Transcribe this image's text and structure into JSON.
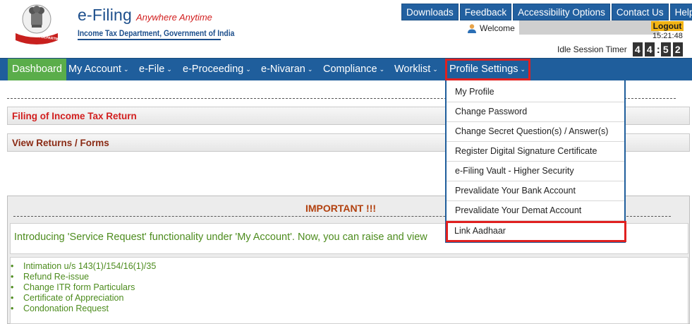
{
  "header": {
    "brand_title": "e-Filing",
    "brand_tagline": "Anywhere Anytime",
    "brand_subtitle": "Income Tax Department, Government of India",
    "emblem_caption": "INCOME TAX DEPARTMENT",
    "top_links": [
      "Downloads",
      "Feedback",
      "Accessibility Options",
      "Contact Us",
      "Help"
    ],
    "welcome_label": "Welcome",
    "logout_label": "Logout",
    "time": "15:21:48",
    "idle_label": "Idle Session Timer",
    "idle_digits": [
      "4",
      "4",
      "5",
      "2"
    ],
    "colors": {
      "brand_blue": "#1d4f8c",
      "tagline_red": "#d21f1f",
      "logout_bg": "#f3b414"
    }
  },
  "nav": {
    "items": [
      {
        "label": "Dashboard",
        "caret": false
      },
      {
        "label": "My Account",
        "caret": true
      },
      {
        "label": "e-File",
        "caret": true
      },
      {
        "label": "e-Proceeding",
        "caret": true
      },
      {
        "label": "e-Nivaran",
        "caret": true
      },
      {
        "label": "Compliance",
        "caret": true
      },
      {
        "label": "Worklist",
        "caret": true
      },
      {
        "label": "Profile Settings",
        "caret": true
      }
    ],
    "caret_glyph": "⌄",
    "active_bg": "#5aad4a",
    "bar_bg": "#1f5e9c"
  },
  "profile_menu": {
    "items": [
      "My Profile",
      "Change Password",
      "Change Secret Question(s) / Answer(s)",
      "Register Digital Signature Certificate",
      "e-Filing Vault - Higher Security",
      "Prevalidate Your Bank Account",
      "Prevalidate Your Demat Account",
      "Link Aadhaar"
    ]
  },
  "main": {
    "panel_filing": "Filing of Income Tax Return",
    "panel_view": "View Returns / Forms",
    "important_title": "IMPORTANT !!!",
    "intro_text": "Introducing 'Service Request' functionality under 'My Account'. Now, you can raise and view",
    "list_items": [
      "Intimation u/s 143(1)/154/16(1)/35",
      "Refund Re-issue",
      "Change ITR form Particulars",
      "Certificate of Appreciation",
      "Condonation Request"
    ]
  }
}
